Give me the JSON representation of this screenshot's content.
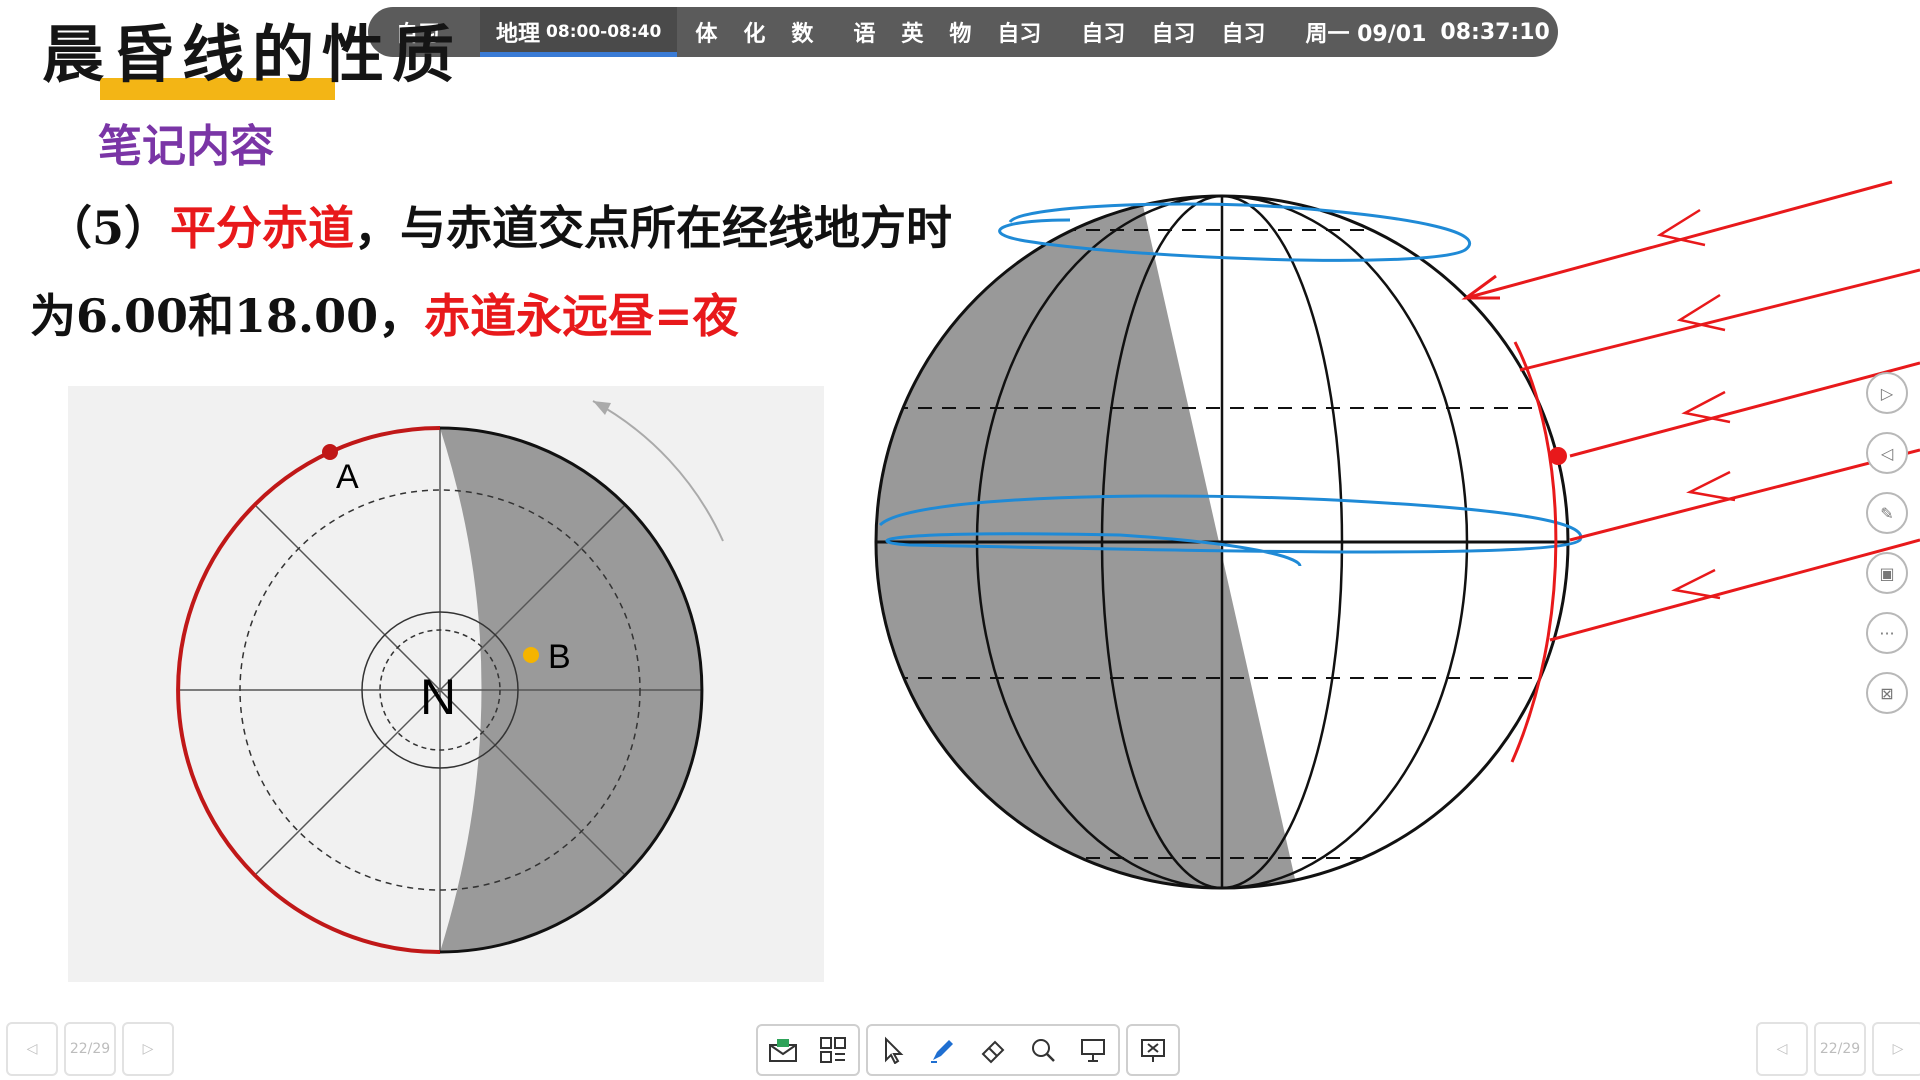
{
  "slide": {
    "title": "晨昏线的性质",
    "subtitle": "笔记内容",
    "line1": {
      "prefix": "（5）",
      "red": "平分赤道",
      "rest": "，与赤道交点所在经线地方时"
    },
    "line2": {
      "prefix": "为6.00和18.00，",
      "red": "赤道永远昼=夜"
    },
    "polar_diagram": {
      "label_a": "A",
      "label_b": "B",
      "label_center": "N"
    }
  },
  "schedule": {
    "items": [
      {
        "text": "自习"
      },
      {
        "text": "地理",
        "time": "08:00-08:40",
        "current": true
      },
      {
        "text": "体"
      },
      {
        "text": "化"
      },
      {
        "text": "数"
      },
      {
        "text": "语"
      },
      {
        "text": "英"
      },
      {
        "text": "物"
      },
      {
        "text": "自习"
      },
      {
        "text": "自习"
      },
      {
        "text": "自习"
      },
      {
        "text": "自习"
      }
    ],
    "date": "周一 09/01",
    "clock": "08:37:10"
  },
  "side_tools": [
    {
      "icon": "next-triangle-icon"
    },
    {
      "icon": "prev-triangle-icon"
    },
    {
      "icon": "pen-slash-icon"
    },
    {
      "icon": "screen-share-icon"
    },
    {
      "icon": "more-dots-icon"
    },
    {
      "icon": "screen-close-icon"
    }
  ],
  "toolbar": {
    "icons": [
      "envelope-icon",
      "qr-grid-icon",
      "pointer-icon",
      "pen-icon",
      "eraser-icon",
      "magnifier-icon",
      "whiteboard-icon",
      "exit-screen-icon"
    ]
  },
  "page_nav": {
    "current": "22/29"
  },
  "colors": {
    "accent_red": "#e8191b",
    "title_underline": "#f3b515",
    "subtitle_purple": "#7a35a6",
    "night_gray": "#9a9a9a",
    "pen_blue": "#1f8ad6",
    "schedule_bg": "#5b5b5b",
    "progress_blue": "#3a7bd5"
  }
}
